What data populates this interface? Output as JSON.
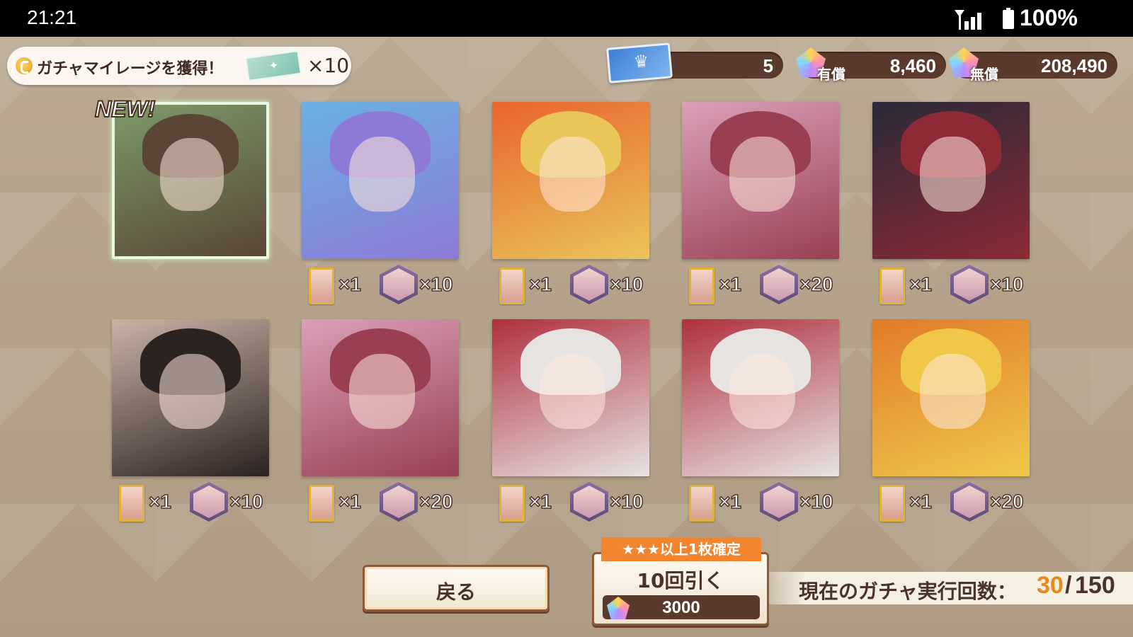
{
  "status_bar": {
    "time": "21:21",
    "battery": "100%"
  },
  "mileage_banner": {
    "text": "ガチャマイレージを獲得！",
    "count": "×10"
  },
  "currencies": {
    "tickets": "5",
    "paid": {
      "tag": "有償",
      "value": "8,460"
    },
    "free": {
      "tag": "無償",
      "value": "208,490"
    }
  },
  "new_label": "NEW!",
  "results": [
    {
      "name": "card-1",
      "new": true,
      "colors": [
        "#5a4637",
        "#7c9a6a"
      ],
      "reward_piece": "",
      "reward_shard": ""
    },
    {
      "name": "card-2",
      "new": false,
      "colors": [
        "#8d7ad6",
        "#6ab0e3"
      ],
      "reward_piece": "×1",
      "reward_shard": "×10"
    },
    {
      "name": "card-3",
      "new": false,
      "colors": [
        "#e9c55a",
        "#e8642c"
      ],
      "reward_piece": "×1",
      "reward_shard": "×10"
    },
    {
      "name": "card-4",
      "new": false,
      "colors": [
        "#9a3f52",
        "#d9a0b8"
      ],
      "reward_piece": "×1",
      "reward_shard": "×20"
    },
    {
      "name": "card-5",
      "new": false,
      "colors": [
        "#8c2a35",
        "#2a2a38"
      ],
      "reward_piece": "×1",
      "reward_shard": "×10"
    },
    {
      "name": "card-6",
      "new": false,
      "colors": [
        "#2c2220",
        "#c9b3a6"
      ],
      "reward_piece": "×1",
      "reward_shard": "×10"
    },
    {
      "name": "card-7",
      "new": false,
      "colors": [
        "#9a3f52",
        "#d9a0b8"
      ],
      "reward_piece": "×1",
      "reward_shard": "×20"
    },
    {
      "name": "card-8",
      "new": false,
      "colors": [
        "#e6e3e0",
        "#b03040"
      ],
      "reward_piece": "×1",
      "reward_shard": "×10"
    },
    {
      "name": "card-9",
      "new": false,
      "colors": [
        "#e6e3e0",
        "#b03040"
      ],
      "reward_piece": "×1",
      "reward_shard": "×10"
    },
    {
      "name": "card-10",
      "new": false,
      "colors": [
        "#efc84a",
        "#e07a2a"
      ],
      "reward_piece": "×1",
      "reward_shard": "×20"
    }
  ],
  "buttons": {
    "back": "戻る"
  },
  "pull": {
    "guarantee": "★★★以上1枚確定",
    "label": "10回引く",
    "cost": "3000"
  },
  "gacha_count": {
    "label": "現在のガチャ実行回数：",
    "current": "30",
    "max": "150"
  }
}
